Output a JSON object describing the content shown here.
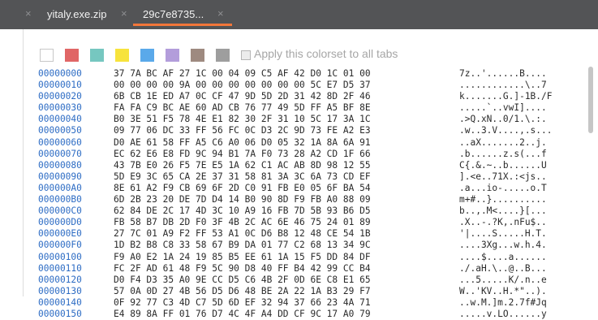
{
  "tabs": [
    {
      "label": "yitaly.exe.zip",
      "close": "×",
      "active": false
    },
    {
      "label": "29c7e8735...",
      "close": "×",
      "active": true
    }
  ],
  "leading_close": "×",
  "colors": {
    "accent": "#f3773a",
    "address": "#2d6cc4"
  },
  "colorset": {
    "swatches": [
      "#ffffff",
      "#e06666",
      "#76c7c0",
      "#f7e33c",
      "#5aa9ea",
      "#b39ddb",
      "#9e8a80",
      "#9e9e9e"
    ],
    "apply_label": "Apply this colorset to all tabs",
    "apply_checked": false
  },
  "hex_rows": [
    {
      "addr": "00000000",
      "bytes": "37 7A BC AF 27 1C 00 04 09 C5 AF 42 D0 1C 01 00",
      "ascii": "7z..'......B...."
    },
    {
      "addr": "00000010",
      "bytes": "00 00 00 00 9A 00 00 00 00 00 00 00 5C E7 D5 37",
      "ascii": "............\\..7"
    },
    {
      "addr": "00000020",
      "bytes": "6B CB 1E ED A7 0C CF 47 9D 5D 2D 31 42 8D 2F 46",
      "ascii": "k.......G.]-1B./F"
    },
    {
      "addr": "00000030",
      "bytes": "FA FA C9 BC AE 60 AD CB 76 77 49 5D FF A5 BF 8E",
      "ascii": ".....`..vwI]...."
    },
    {
      "addr": "00000040",
      "bytes": "B0 3E 51 F5 78 4E E1 82 30 2F 31 10 5C 17 3A 1C",
      "ascii": ".>Q.xN..0/1.\\.:."
    },
    {
      "addr": "00000050",
      "bytes": "09 77 06 DC 33 FF 56 FC 0C D3 2C 9D 73 FE A2 E3",
      "ascii": ".w..3.V....,.s..."
    },
    {
      "addr": "00000060",
      "bytes": "D0 AE 61 58 FF A5 C6 A0 06 D0 05 32 1A 8A 6A 91",
      "ascii": "..aX.......2..j."
    },
    {
      "addr": "00000070",
      "bytes": "EC 62 E6 E8 FD 9C 94 B1 7A F0 73 28 A2 CD 1F 66",
      "ascii": ".b......z.s(...f"
    },
    {
      "addr": "00000080",
      "bytes": "43 7B E0 26 F5 7E E5 1A 62 C1 AC AB 8D 98 12 55",
      "ascii": "C{.&.~..b......U"
    },
    {
      "addr": "00000090",
      "bytes": "5D E9 3C 65 CA 2E 37 31 58 81 3A 3C 6A 73 CD EF",
      "ascii": "].<e..71X.:<js.."
    },
    {
      "addr": "000000A0",
      "bytes": "8E 61 A2 F9 CB 69 6F 2D C0 91 FB E0 05 6F BA 54",
      "ascii": ".a...io-.....o.T"
    },
    {
      "addr": "000000B0",
      "bytes": "6D 2B 23 20 DE 7D D4 14 B0 90 8D F9 FB A0 88 09",
      "ascii": "m+#..}.........."
    },
    {
      "addr": "000000C0",
      "bytes": "62 84 DE 2C 17 4D 3C 10 A9 16 FB 7D 5B 93 B6 D5",
      "ascii": "b..,.M<....}[..."
    },
    {
      "addr": "000000D0",
      "bytes": "FB 58 B7 DB 2D F0 3F 4B 2C AC 6E 46 75 24 01 89",
      "ascii": ".X..-.?K,.nFu$.."
    },
    {
      "addr": "000000E0",
      "bytes": "27 7C 01 A9 F2 FF 53 A1 0C D6 B8 12 48 CE 54 1B",
      "ascii": "'|....S.....H.T."
    },
    {
      "addr": "000000F0",
      "bytes": "1D B2 B8 C8 33 58 67 B9 DA 01 77 C2 68 13 34 9C",
      "ascii": "....3Xg...w.h.4."
    },
    {
      "addr": "00000100",
      "bytes": "F9 A0 E2 1A 24 19 85 B5 EE 61 1A 15 F5 DD 84 DF",
      "ascii": "....$....a......"
    },
    {
      "addr": "00000110",
      "bytes": "FC 2F AD 61 48 F9 5C 90 D8 40 FF B4 42 99 CC B4",
      "ascii": "./.aH.\\..@..B..."
    },
    {
      "addr": "00000120",
      "bytes": "D0 F4 D3 35 A0 9E CC D5 C6 4B 2F 0D 6E C8 E1 65",
      "ascii": "...5.....K/.n..e"
    },
    {
      "addr": "00000130",
      "bytes": "57 0A 0D 27 4B 56 D5 D6 48 BE 2A 22 1A B3 29 F7",
      "ascii": "W..'KV..H.*\"..)."
    },
    {
      "addr": "00000140",
      "bytes": "0F 92 77 C3 4D C7 5D 6D EF 32 94 37 66 23 4A 71",
      "ascii": "..w.M.]m.2.7f#Jq"
    },
    {
      "addr": "00000150",
      "bytes": "E4 89 8A FF 01 76 D7 4C 4F A4 DD CF 9C 17 A0 79",
      "ascii": ".....v.LO......y"
    }
  ]
}
